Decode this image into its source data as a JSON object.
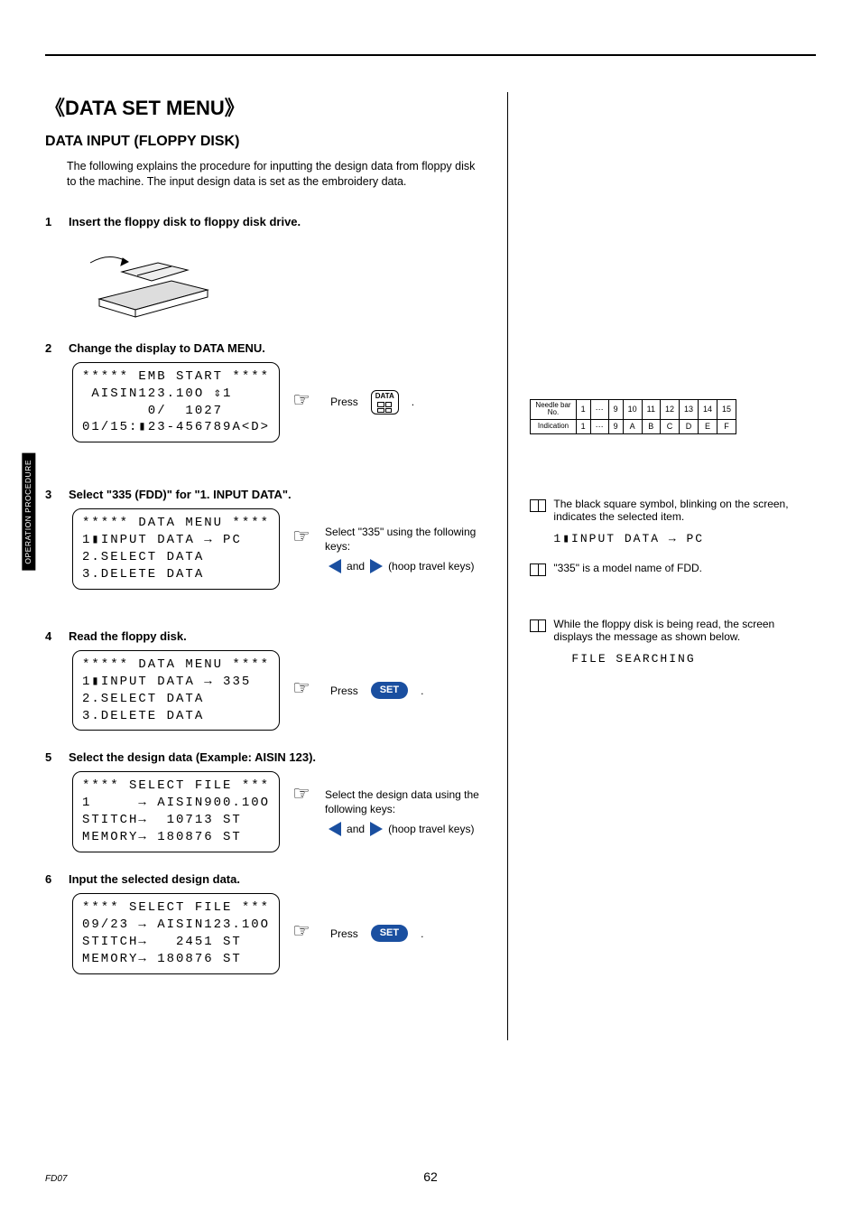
{
  "header": {
    "title": "《DATA SET MENU》",
    "subtitle": "DATA INPUT (FLOPPY DISK)",
    "intro": "The following explains the procedure for inputting the design data from floppy disk to the machine.  The input design data is set as the embroidery data."
  },
  "side_tab": "OPERATION\nPROCEDURE",
  "steps": {
    "s1": {
      "num": "1",
      "title": "Insert the floppy disk to floppy disk drive."
    },
    "s2": {
      "num": "2",
      "title": "Change the display to DATA MENU.",
      "lcd": "***** EMB START ****\n AISIN123.10O ⇕1\n       0/  1027\n01/15:▮23-456789A<D>",
      "press": "Press",
      "btn_label": "DATA",
      "period": "."
    },
    "s3": {
      "num": "3",
      "title": "Select \"335 (FDD)\" for \"1. INPUT DATA\".",
      "lcd": "***** DATA MENU ****\n1▮INPUT DATA → PC\n2.SELECT DATA\n3.DELETE DATA",
      "instr1": "Select \"335\" using the following keys:",
      "instr2_and": "and",
      "instr2_keys": "(hoop travel keys)"
    },
    "s4": {
      "num": "4",
      "title": "Read the floppy disk.",
      "lcd": "***** DATA MENU ****\n1▮INPUT DATA → 335\n2.SELECT DATA\n3.DELETE DATA",
      "press": "Press",
      "btn_label": "SET",
      "period": "."
    },
    "s5": {
      "num": "5",
      "title": "Select the design data (Example: AISIN 123).",
      "lcd": "**** SELECT FILE ***\n1     → AISIN900.10O\nSTITCH→  10713 ST\nMEMORY→ 180876 ST",
      "instr1": "Select the design data using the following keys:",
      "instr2_and": "and",
      "instr2_keys": "(hoop travel keys)"
    },
    "s6": {
      "num": "6",
      "title": "Input the selected design data.",
      "lcd": "**** SELECT FILE ***\n09/23 → AISIN123.10O\nSTITCH→   2451 ST\nMEMORY→ 180876 ST",
      "press": "Press",
      "btn_label": "SET",
      "period": "."
    }
  },
  "right": {
    "needle_table": {
      "row1_label": "Needle bar\nNo.",
      "row2_label": "Indication",
      "cols": [
        "1",
        "⋯",
        "9",
        "10",
        "11",
        "12",
        "13",
        "14",
        "15"
      ],
      "ind": [
        "1",
        "⋯",
        "9",
        "A",
        "B",
        "C",
        "D",
        "E",
        "F"
      ]
    },
    "note1": {
      "text": "The black square symbol, blinking on the screen, indicates the selected item.",
      "lcd": "1▮INPUT DATA → PC"
    },
    "note2": {
      "text": "\"335\" is a model name of FDD."
    },
    "note3": {
      "text": "While the floppy disk is being read, the screen displays the message as shown below.",
      "lcd": "FILE SEARCHING"
    }
  },
  "footer": {
    "code": "FD07",
    "page": "62"
  }
}
